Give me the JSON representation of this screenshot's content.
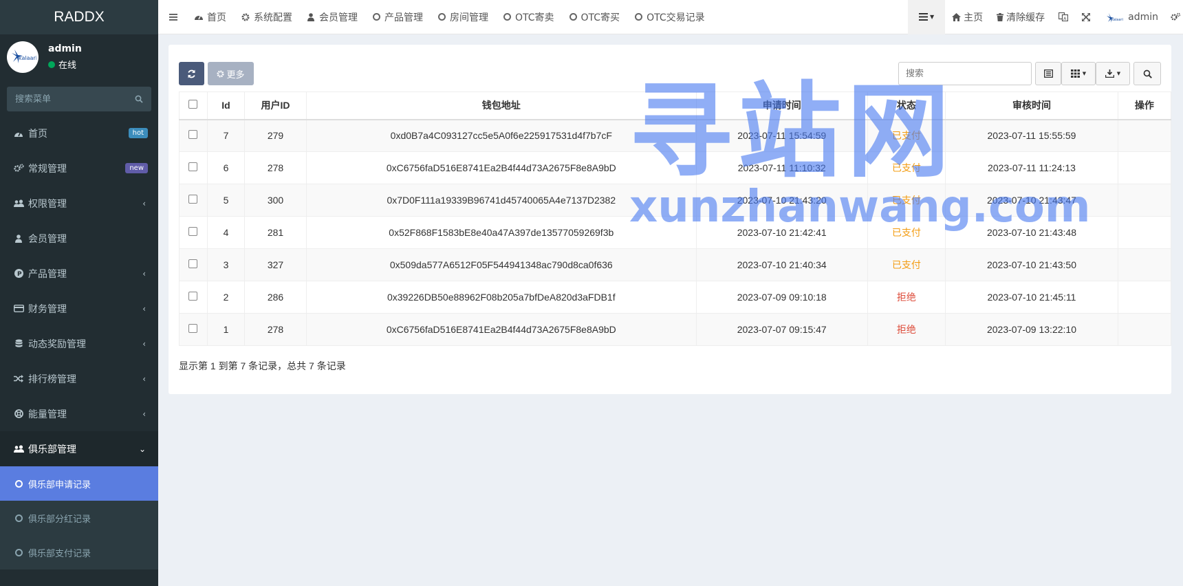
{
  "app": {
    "title": "RADDX"
  },
  "user": {
    "name": "admin",
    "status": "在线"
  },
  "sidebar": {
    "search_placeholder": "搜索菜单",
    "items": [
      {
        "label": "首页",
        "badge": "hot"
      },
      {
        "label": "常规管理",
        "badge": "new"
      },
      {
        "label": "权限管理"
      },
      {
        "label": "会员管理"
      },
      {
        "label": "产品管理"
      },
      {
        "label": "财务管理"
      },
      {
        "label": "动态奖励管理"
      },
      {
        "label": "排行榜管理"
      },
      {
        "label": "能量管理"
      },
      {
        "label": "俱乐部管理"
      }
    ],
    "subitems": [
      {
        "label": "俱乐部申请记录"
      },
      {
        "label": "俱乐部分红记录"
      },
      {
        "label": "俱乐部支付记录"
      }
    ]
  },
  "topbar": {
    "tabs": [
      {
        "label": "首页"
      },
      {
        "label": "系统配置"
      },
      {
        "label": "会员管理"
      },
      {
        "label": "产品管理"
      },
      {
        "label": "房间管理"
      },
      {
        "label": "OTC寄卖"
      },
      {
        "label": "OTC寄买"
      },
      {
        "label": "OTC交易记录"
      }
    ],
    "home": "主页",
    "clear_cache": "清除缓存",
    "admin": "admin"
  },
  "toolbar": {
    "more": "更多",
    "search_placeholder": "搜索"
  },
  "table": {
    "headers": [
      "Id",
      "用户ID",
      "钱包地址",
      "申请时间",
      "状态",
      "审核时间",
      "操作"
    ],
    "rows": [
      {
        "id": "7",
        "uid": "279",
        "wallet": "0xd0B7a4C093127cc5e5A0f6e225917531d4f7b7cF",
        "apply": "2023-07-11 15:54:59",
        "status": "已支付",
        "review": "2023-07-11 15:55:59"
      },
      {
        "id": "6",
        "uid": "278",
        "wallet": "0xC6756faD516E8741Ea2B4f44d73A2675F8e8A9bD",
        "apply": "2023-07-11 11:10:32",
        "status": "已支付",
        "review": "2023-07-11 11:24:13"
      },
      {
        "id": "5",
        "uid": "300",
        "wallet": "0x7D0F111a19339B96741d45740065A4e7137D2382",
        "apply": "2023-07-10 21:43:20",
        "status": "已支付",
        "review": "2023-07-10 21:43:47"
      },
      {
        "id": "4",
        "uid": "281",
        "wallet": "0x52F868F1583bE8e40a47A397de13577059269f3b",
        "apply": "2023-07-10 21:42:41",
        "status": "已支付",
        "review": "2023-07-10 21:43:48"
      },
      {
        "id": "3",
        "uid": "327",
        "wallet": "0x509da577A6512F05F544941348ac790d8ca0f636",
        "apply": "2023-07-10 21:40:34",
        "status": "已支付",
        "review": "2023-07-10 21:43:50"
      },
      {
        "id": "2",
        "uid": "286",
        "wallet": "0x39226DB50e88962F08b205a7bfDeA820d3aFDB1f",
        "apply": "2023-07-09 09:10:18",
        "status": "拒绝",
        "review": "2023-07-10 21:45:11"
      },
      {
        "id": "1",
        "uid": "278",
        "wallet": "0xC6756faD516E8741Ea2B4f44d73A2675F8e8A9bD",
        "apply": "2023-07-07 09:15:47",
        "status": "拒绝",
        "review": "2023-07-09 13:22:10"
      }
    ]
  },
  "pagination": {
    "info": "显示第 1 到第 7 条记录，总共 7 条记录"
  },
  "watermark": {
    "cn": "寻站网",
    "en": "xunzhanwang.com"
  },
  "colors": {
    "sidebar": "#222d32",
    "active": "#5a7de0",
    "paid": "#f39c12",
    "rejected": "#dd4b39",
    "badge_hot": "#3c8dbc",
    "badge_new": "#605ca8"
  }
}
